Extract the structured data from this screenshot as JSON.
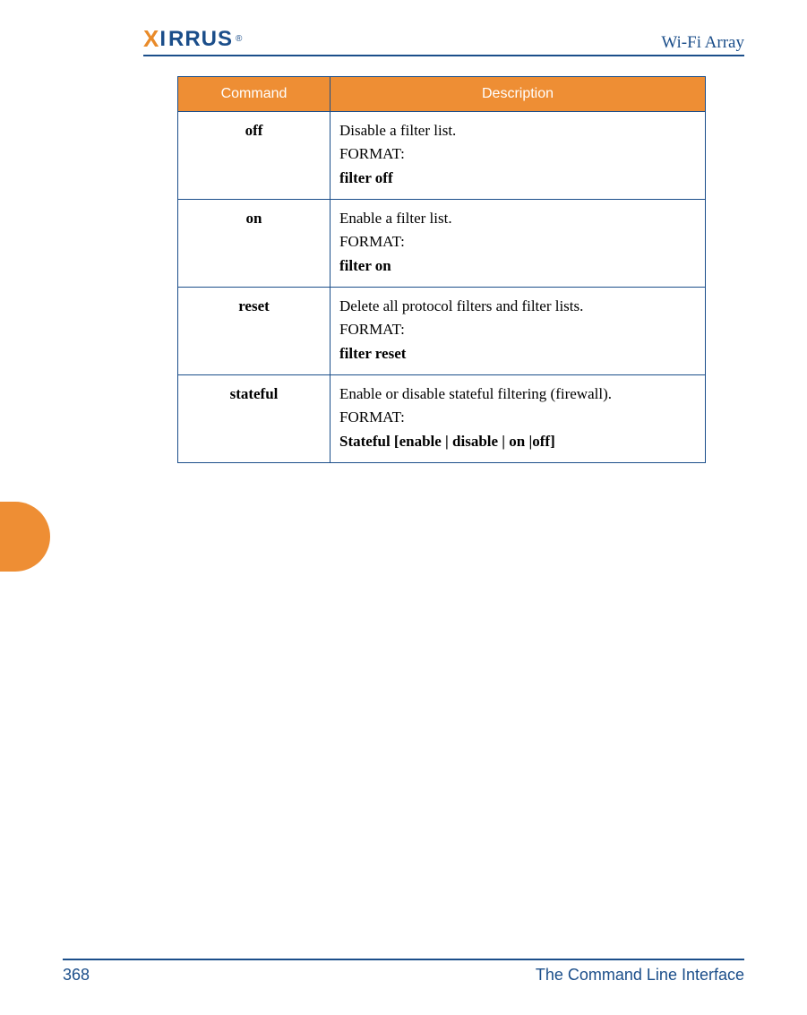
{
  "header": {
    "brand": "XIRRUS",
    "product": "Wi-Fi Array"
  },
  "table": {
    "headers": {
      "command": "Command",
      "description": "Description"
    },
    "format_label": "FORMAT:",
    "rows": [
      {
        "command": "off",
        "description": "Disable a filter list.",
        "format": "filter off"
      },
      {
        "command": "on",
        "description": "Enable a filter list.",
        "format": "filter on"
      },
      {
        "command": "reset",
        "description": "Delete all protocol filters and filter lists.",
        "format": "filter reset"
      },
      {
        "command": "stateful",
        "description": "Enable or disable stateful filtering (firewall).",
        "format": "Stateful [enable | disable | on  |off]"
      }
    ]
  },
  "footer": {
    "page": "368",
    "section": "The Command Line Interface"
  }
}
